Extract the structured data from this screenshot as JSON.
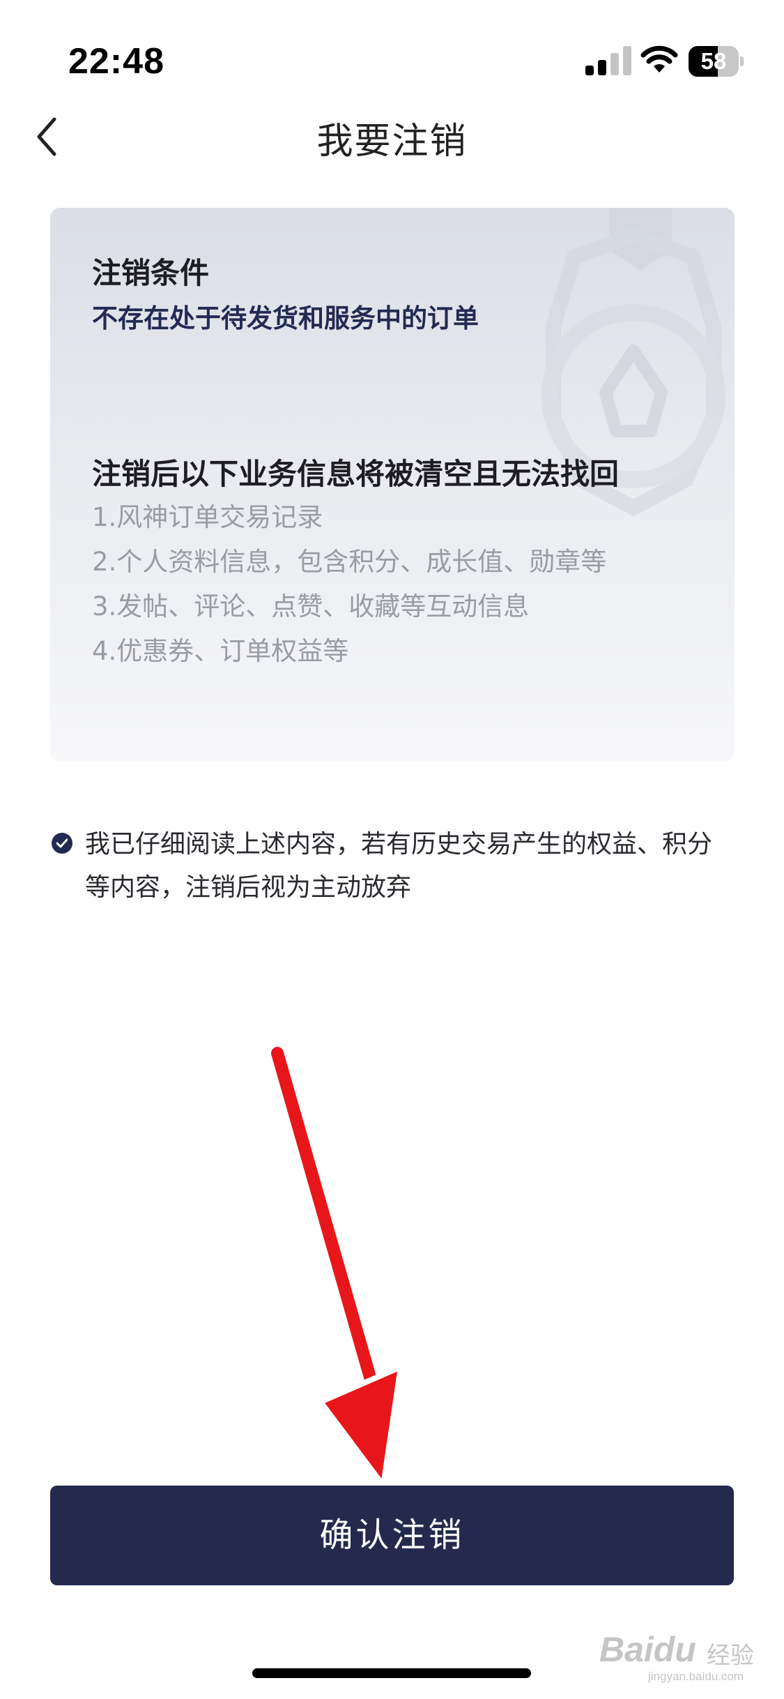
{
  "status_bar": {
    "time": "22:48",
    "battery_percent": 58,
    "battery_label": "58",
    "signal_bars_active": 2,
    "signal_bars_total": 4
  },
  "nav": {
    "back_icon": "chevron-left-icon",
    "title": "我要注销"
  },
  "card": {
    "condition_title": "注销条件",
    "condition_text": "不存在处于待发货和服务中的订单",
    "clear_title": "注销后以下业务信息将被清空且无法找回",
    "clear_items": [
      "1.风神订单交易记录",
      "2.个人资料信息，包含积分、成长值、勋章等",
      "3.发帖、评论、点赞、收藏等互动信息",
      "4.优惠券、订单权益等"
    ]
  },
  "agreement": {
    "checked": true,
    "text": "我已仔细阅读上述内容，若有历史交易产生的权益、积分等内容，注销后视为主动放弃"
  },
  "confirm_button": {
    "label": "确认注销"
  },
  "watermark": {
    "brand": "Baidu",
    "sub": "经验",
    "url": "jingyan.baidu.com"
  },
  "colors": {
    "primary": "#232a4e",
    "arrow": "#e8161a",
    "muted_text": "#9a9ca3"
  }
}
